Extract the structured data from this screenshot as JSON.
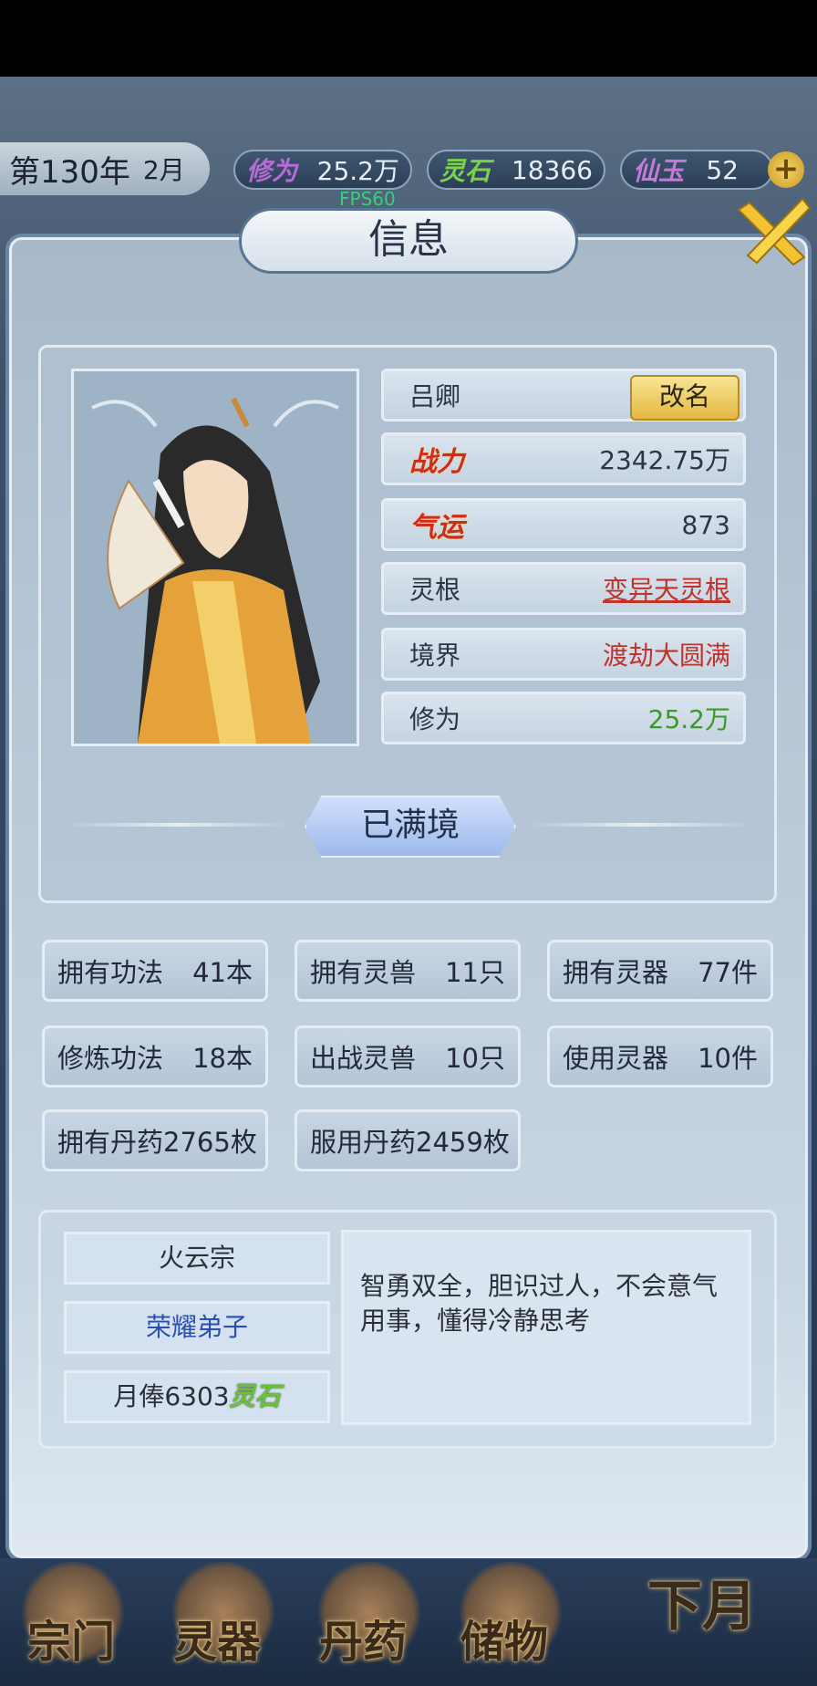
{
  "topbar": {
    "year": "第130年",
    "month": "2月",
    "resources": [
      {
        "label": "修为",
        "value": "25.2万",
        "label_color": "#b76bd6"
      },
      {
        "label": "灵石",
        "value": "18366",
        "label_color": "#7ad14b"
      },
      {
        "label": "仙玉",
        "value": "52",
        "label_color": "#c57ad8"
      }
    ],
    "fps": "FPS60"
  },
  "dialog": {
    "title": "信息"
  },
  "character": {
    "name": "吕卿",
    "rename_label": "改名",
    "rows": [
      {
        "label": "战力",
        "value": "2342.75万",
        "label_style": "red",
        "value_color": "#2f3442"
      },
      {
        "label": "气运",
        "value": "873",
        "label_style": "red",
        "value_color": "#2f3442"
      },
      {
        "label": "灵根",
        "value": "变异天灵根",
        "label_style": "plain",
        "value_color": "#c0322a"
      },
      {
        "label": "境界",
        "value": "渡劫大圆满",
        "label_style": "plain",
        "value_color": "#c0322a"
      },
      {
        "label": "修为",
        "value": "25.2万",
        "label_style": "plain",
        "value_color": "#3a9a22"
      }
    ],
    "status": "已满境"
  },
  "stats": [
    {
      "label": "拥有功法",
      "value": "41本"
    },
    {
      "label": "拥有灵兽",
      "value": "11只"
    },
    {
      "label": "拥有灵器",
      "value": "77件"
    },
    {
      "label": "修炼功法",
      "value": "18本"
    },
    {
      "label": "出战灵兽",
      "value": "10只"
    },
    {
      "label": "使用灵器",
      "value": "10件"
    },
    {
      "label": "拥有丹药",
      "value": "2765枚"
    },
    {
      "label": "服用丹药",
      "value": "2459枚"
    }
  ],
  "sect": {
    "name": "火云宗",
    "rank": "荣耀弟子",
    "salary_prefix": "月俸6303",
    "salary_unit": "灵石",
    "description": "智勇双全，胆识过人，不会意气用事，懂得冷静思考"
  },
  "bottom_nav": [
    "宗门",
    "灵器",
    "丹药",
    "储物",
    "下月"
  ]
}
